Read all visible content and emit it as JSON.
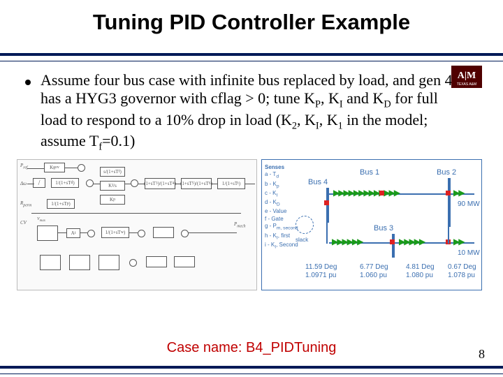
{
  "title": "Tuning PID Controller Example",
  "bullet_html": "Assume four bus case  with infinite bus replaced by load, and gen 4 has a HYG3 governor with cflag > 0; tune K<sub>P</sub>, K<sub>I</sub> and K<sub>D</sub> for full load to respond to a 10% drop in load (K<sub>2</sub>, K<sub>I</sub>, K<sub>1</sub> in the model; assume T<sub>f</sub>=0.1)",
  "case_name": "Case name: B4_PIDTuning",
  "page_number": "8",
  "block_diagram": {
    "blocks": {
      "kgov": "K<sub>gov</sub>",
      "tf1": "1/(1+sT<sub>d</sub>)",
      "tf2": "s/(1+sT<sub>f</sub>)",
      "ki_s": "K<sub>I</sub>/s",
      "kp": "K<sub>p</sub>",
      "tf3": "(1+sT<sub>3</sub>)/(1+sT<sub>4</sub>)",
      "tf4": "(1+sT<sub>5</sub>)/(1+sT<sub>6</sub>)",
      "tf5": "1/(1+sT<sub>t</sub>)",
      "tf6": "1/(1+sT<sub>p</sub>)",
      "dbd": "",
      "lim": "V<sub>max</sub>",
      "at": "A<sub>t</sub>",
      "turb": "1/(1+sT<sub>w</sub>)"
    },
    "labels": {
      "pref": "P<sub>ref</sub>",
      "dw": "Δω",
      "rperm": "R<sub>perm</sub>",
      "cv": "CV",
      "pmech": "P<sub>mech</sub>",
      "senses": "Senses",
      "legend": [
        "a - T<sub>d</sub>",
        "b - K<sub>p</sub>",
        "c - K<sub>I</sub>",
        "d - K<sub>D</sub>",
        "e - Value",
        "f - Gate",
        "g - P<sub>m, second</sub>",
        "h - K<sub>I</sub>, first",
        "i - K<sub>I</sub>, Second"
      ]
    }
  },
  "bus_figure": {
    "buses": {
      "bus1": {
        "label": "Bus 1",
        "deg": "0.67 Deg",
        "pu": "1.078 pu"
      },
      "bus2": {
        "label": "Bus 2",
        "deg": "4.81 Deg",
        "pu": "1.080 pu"
      },
      "bus3": {
        "label": "Bus 3",
        "deg": "6.77 Deg",
        "pu": "1.060 pu"
      },
      "bus4": {
        "label": "Bus 4",
        "deg": "11.59 Deg",
        "pu": "1.0971 pu"
      }
    },
    "slack": "slack",
    "loads": {
      "l1": "90 MW",
      "l2": "10 MW"
    }
  }
}
